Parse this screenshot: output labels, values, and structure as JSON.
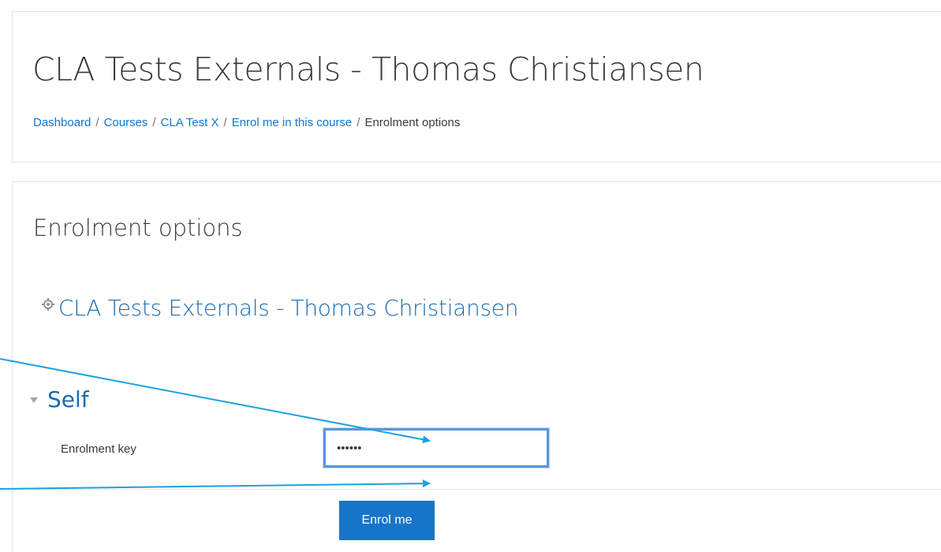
{
  "header": {
    "title": "CLA Tests Externals - Thomas Christiansen",
    "breadcrumb": [
      {
        "label": "Dashboard",
        "link": true
      },
      {
        "label": "Courses",
        "link": true
      },
      {
        "label": "CLA Test X",
        "link": true
      },
      {
        "label": "Enrol me in this course",
        "link": true
      },
      {
        "label": "Enrolment options",
        "link": false
      }
    ],
    "breadcrumb_separator": "/"
  },
  "main": {
    "heading": "Enrolment options",
    "course_link": "CLA Tests Externals - Thomas Christiansen",
    "course_icon": "course-cog-icon",
    "self_section": {
      "label": "Self",
      "toggle_icon": "caret-down-icon",
      "field_label": "Enrolment key",
      "field_value": "••••••",
      "button_label": "Enrol me"
    }
  },
  "colors": {
    "link": "#1177d1",
    "heading_link": "#1a6bb0",
    "button": "#1874c9",
    "focus_border": "#5c97d6",
    "arrow": "#1ba1e2"
  }
}
